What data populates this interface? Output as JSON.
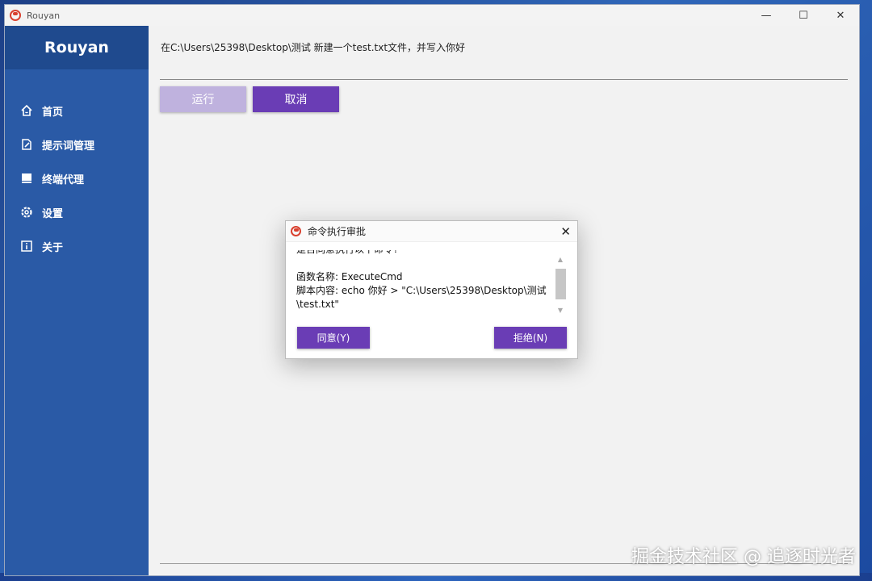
{
  "window": {
    "title": "Rouyan",
    "controls": {
      "minimize": "—",
      "maximize": "☐",
      "close": "✕"
    }
  },
  "sidebar": {
    "brand": "Rouyan",
    "items": [
      {
        "label": "首页",
        "icon": "home-icon"
      },
      {
        "label": "提示词管理",
        "icon": "edit-icon"
      },
      {
        "label": "终端代理",
        "icon": "terminal-icon"
      },
      {
        "label": "设置",
        "icon": "gear-icon"
      },
      {
        "label": "关于",
        "icon": "info-icon"
      }
    ]
  },
  "main": {
    "prompt": "在C:\\Users\\25398\\Desktop\\测试 新建一个test.txt文件，并写入你好",
    "run_label": "运行",
    "cancel_label": "取消"
  },
  "dialog": {
    "title": "命令执行审批",
    "close": "✕",
    "lines": [
      "是否同意执行以下命令?",
      "",
      "函数名称: ExecuteCmd",
      "脚本内容: echo 你好 > \"C:\\Users\\25398\\Desktop\\测试",
      "\\test.txt\""
    ],
    "agree_label": "同意(Y)",
    "reject_label": "拒绝(N)"
  },
  "watermark": "掘金技术社区 @ 追逐时光者"
}
